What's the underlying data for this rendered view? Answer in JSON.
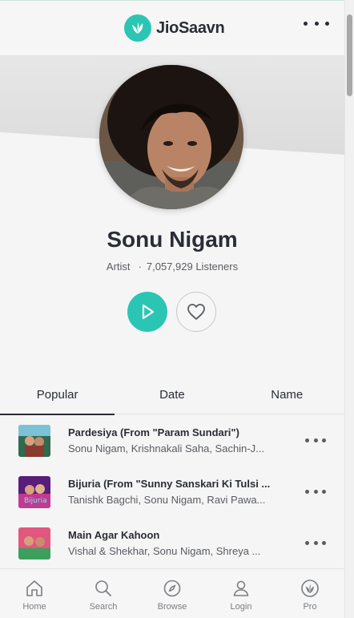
{
  "header": {
    "logo_text": "JioSaavn",
    "logo_icon": "jiosaavn-logo-icon",
    "more_icon": "more-horizontal-icon"
  },
  "artist": {
    "name": "Sonu Nigam",
    "type": "Artist",
    "separator": "·",
    "listeners": "7,057,929 Listeners",
    "play_icon": "play-icon",
    "favorite_icon": "heart-icon"
  },
  "tabs": [
    {
      "label": "Popular",
      "active": true
    },
    {
      "label": "Date",
      "active": false
    },
    {
      "label": "Name",
      "active": false
    }
  ],
  "songs": [
    {
      "title": "Pardesiya (From \"Param Sundari\")",
      "artists": "Sonu Nigam, Krishnakali Saha, Sachin-J..."
    },
    {
      "title": "Bijuria (From \"Sunny Sanskari Ki Tulsi ...",
      "artists": "Tanishk Bagchi, Sonu Nigam, Ravi Pawa..."
    },
    {
      "title": "Main Agar Kahoon",
      "artists": "Vishal & Shekhar, Sonu Nigam, Shreya ..."
    }
  ],
  "bottom_nav": [
    {
      "label": "Home",
      "icon": "home-icon"
    },
    {
      "label": "Search",
      "icon": "search-icon"
    },
    {
      "label": "Browse",
      "icon": "compass-icon"
    },
    {
      "label": "Login",
      "icon": "user-icon"
    },
    {
      "label": "Pro",
      "icon": "jiosaavn-pro-icon"
    }
  ],
  "colors": {
    "accent": "#2bc5b4",
    "text_primary": "#2a2d36",
    "text_secondary": "#595c62",
    "background": "#f5f5f5"
  }
}
